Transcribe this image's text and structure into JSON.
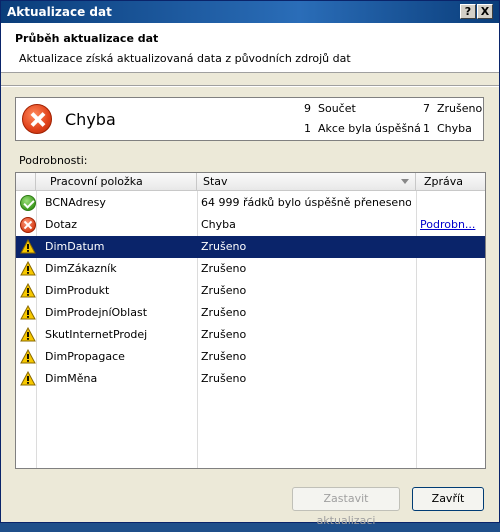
{
  "window": {
    "title": "Aktualizace dat",
    "help": "?",
    "close": "X"
  },
  "header": {
    "title": "Průběh aktualizace dat",
    "description": "Aktualizace získá aktualizovaná data z původních zdrojů dat"
  },
  "status": {
    "text": "Chyba",
    "total_count": "9",
    "total_label": "Součet",
    "success_count": "1",
    "success_label": "Akce byla úspěšná",
    "cancelled_count": "7",
    "cancelled_label": "Zrušeno",
    "error_count": "1",
    "error_label": "Chyba"
  },
  "details": {
    "label": "Podrobnosti:",
    "columns": [
      "Pracovní položka",
      "Stav",
      "Zpráva"
    ],
    "rows": [
      {
        "icon": "success-icon",
        "item": "BCNAdresy",
        "status": "64 999 řádků bylo úspěšně přeneseno.",
        "message": ""
      },
      {
        "icon": "error-icon",
        "item": "Dotaz",
        "status": "Chyba",
        "message": "Podrobn..."
      },
      {
        "icon": "warning-icon",
        "item": "DimDatum",
        "status": "Zrušeno",
        "message": ""
      },
      {
        "icon": "warning-icon",
        "item": "DimZákazník",
        "status": "Zrušeno",
        "message": ""
      },
      {
        "icon": "warning-icon",
        "item": "DimProdukt",
        "status": "Zrušeno",
        "message": ""
      },
      {
        "icon": "warning-icon",
        "item": "DimProdejníOblast",
        "status": "Zrušeno",
        "message": ""
      },
      {
        "icon": "warning-icon",
        "item": "SkutInternetProdej",
        "status": "Zrušeno",
        "message": ""
      },
      {
        "icon": "warning-icon",
        "item": "DimPropagace",
        "status": "Zrušeno",
        "message": ""
      },
      {
        "icon": "warning-icon",
        "item": "DimMěna",
        "status": "Zrušeno",
        "message": ""
      }
    ]
  },
  "buttons": {
    "stop": "Zastavit aktualizaci",
    "close": "Zavřít"
  },
  "colors": {
    "selection": "#0a246a",
    "link": "#0000cc"
  }
}
